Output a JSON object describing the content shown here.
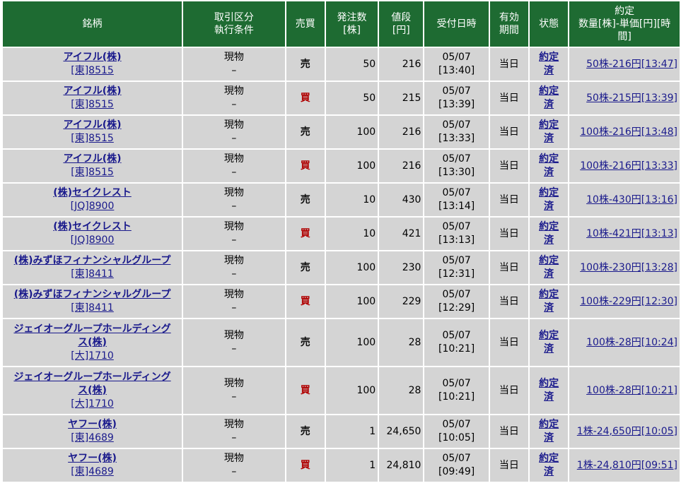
{
  "headers": {
    "name": "銘柄",
    "kind_1": "取引区分",
    "kind_2": "執行条件",
    "side": "売買",
    "qty_1": "発注数",
    "qty_2": "[株]",
    "price_1": "値段",
    "price_2": "[円]",
    "time": "受付日時",
    "valid_1": "有効",
    "valid_2": "期間",
    "state": "状態",
    "exec_1": "約定",
    "exec_2": "数量[株]-単価[円][時",
    "exec_3": "間]"
  },
  "rows": [
    {
      "name_1": "アイフル(株)",
      "name_2": "",
      "code": "[東]8515",
      "kind": "現物",
      "cond": "–",
      "side": "売",
      "qty": "50",
      "price": "216",
      "date": "05/07",
      "time": "[13:40]",
      "valid": "当日",
      "state_1": "約定",
      "state_2": "済",
      "exec": "50株-216円[13:47]"
    },
    {
      "name_1": "アイフル(株)",
      "name_2": "",
      "code": "[東]8515",
      "kind": "現物",
      "cond": "–",
      "side": "買",
      "qty": "50",
      "price": "215",
      "date": "05/07",
      "time": "[13:39]",
      "valid": "当日",
      "state_1": "約定",
      "state_2": "済",
      "exec": "50株-215円[13:39]"
    },
    {
      "name_1": "アイフル(株)",
      "name_2": "",
      "code": "[東]8515",
      "kind": "現物",
      "cond": "–",
      "side": "売",
      "qty": "100",
      "price": "216",
      "date": "05/07",
      "time": "[13:33]",
      "valid": "当日",
      "state_1": "約定",
      "state_2": "済",
      "exec": "100株-216円[13:48]"
    },
    {
      "name_1": "アイフル(株)",
      "name_2": "",
      "code": "[東]8515",
      "kind": "現物",
      "cond": "–",
      "side": "買",
      "qty": "100",
      "price": "216",
      "date": "05/07",
      "time": "[13:30]",
      "valid": "当日",
      "state_1": "約定",
      "state_2": "済",
      "exec": "100株-216円[13:33]"
    },
    {
      "name_1": "(株)セイクレスト",
      "name_2": "",
      "code": "[JQ]8900",
      "kind": "現物",
      "cond": "–",
      "side": "売",
      "qty": "10",
      "price": "430",
      "date": "05/07",
      "time": "[13:14]",
      "valid": "当日",
      "state_1": "約定",
      "state_2": "済",
      "exec": "10株-430円[13:16]"
    },
    {
      "name_1": "(株)セイクレスト",
      "name_2": "",
      "code": "[JQ]8900",
      "kind": "現物",
      "cond": "–",
      "side": "買",
      "qty": "10",
      "price": "421",
      "date": "05/07",
      "time": "[13:13]",
      "valid": "当日",
      "state_1": "約定",
      "state_2": "済",
      "exec": "10株-421円[13:13]"
    },
    {
      "name_1": "(株)みずほフィナンシャルグループ",
      "name_2": "",
      "code": "[東]8411",
      "kind": "現物",
      "cond": "–",
      "side": "売",
      "qty": "100",
      "price": "230",
      "date": "05/07",
      "time": "[12:31]",
      "valid": "当日",
      "state_1": "約定",
      "state_2": "済",
      "exec": "100株-230円[13:28]"
    },
    {
      "name_1": "(株)みずほフィナンシャルグループ",
      "name_2": "",
      "code": "[東]8411",
      "kind": "現物",
      "cond": "–",
      "side": "買",
      "qty": "100",
      "price": "229",
      "date": "05/07",
      "time": "[12:29]",
      "valid": "当日",
      "state_1": "約定",
      "state_2": "済",
      "exec": "100株-229円[12:30]"
    },
    {
      "name_1": "ジェイオーグループホールディング",
      "name_2": "ス(株)",
      "code": "[大]1710",
      "kind": "現物",
      "cond": "–",
      "side": "売",
      "qty": "100",
      "price": "28",
      "date": "05/07",
      "time": "[10:21]",
      "valid": "当日",
      "state_1": "約定",
      "state_2": "済",
      "exec": "100株-28円[10:24]"
    },
    {
      "name_1": "ジェイオーグループホールディング",
      "name_2": "ス(株)",
      "code": "[大]1710",
      "kind": "現物",
      "cond": "–",
      "side": "買",
      "qty": "100",
      "price": "28",
      "date": "05/07",
      "time": "[10:21]",
      "valid": "当日",
      "state_1": "約定",
      "state_2": "済",
      "exec": "100株-28円[10:21]"
    },
    {
      "name_1": "ヤフー(株)",
      "name_2": "",
      "code": "[東]4689",
      "kind": "現物",
      "cond": "–",
      "side": "売",
      "qty": "1",
      "price": "24,650",
      "date": "05/07",
      "time": "[10:05]",
      "valid": "当日",
      "state_1": "約定",
      "state_2": "済",
      "exec": "1株-24,650円[10:05]"
    },
    {
      "name_1": "ヤフー(株)",
      "name_2": "",
      "code": "[東]4689",
      "kind": "現物",
      "cond": "–",
      "side": "買",
      "qty": "1",
      "price": "24,810",
      "date": "05/07",
      "time": "[09:49]",
      "valid": "当日",
      "state_1": "約定",
      "state_2": "済",
      "exec": "1株-24,810円[09:51]"
    }
  ]
}
